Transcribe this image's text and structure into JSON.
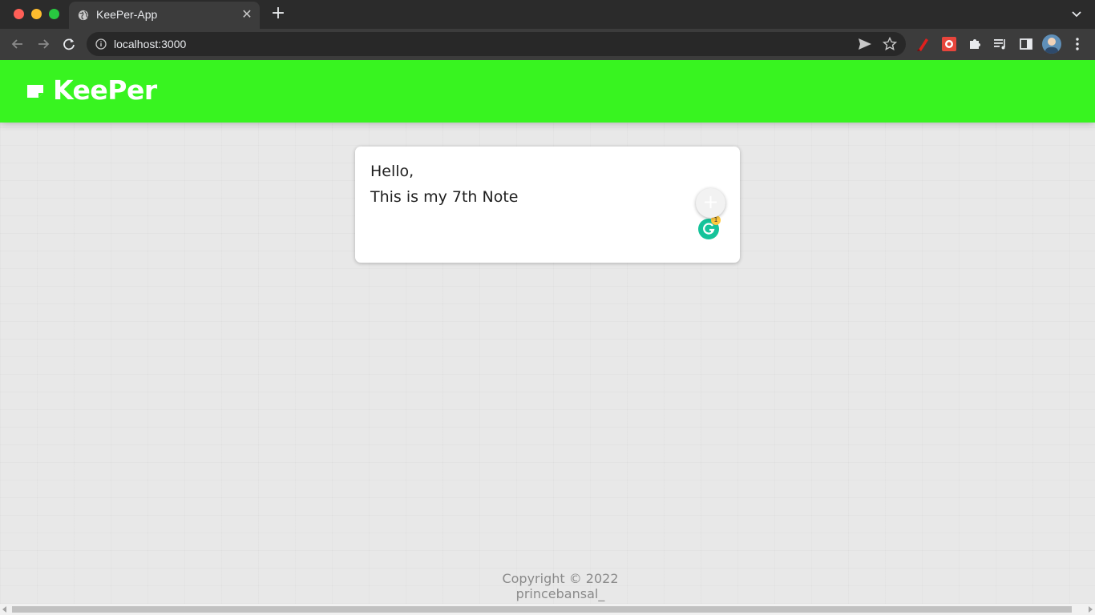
{
  "browser": {
    "tab": {
      "title": "KeePer-App",
      "close_glyph": "✕",
      "icon": "globe-icon"
    },
    "new_tab_glyph": "+",
    "address": {
      "url": "localhost:3000",
      "icon": "info-icon"
    },
    "extensions": [
      "pen-icon",
      "red-extension-icon",
      "puzzle-icon",
      "media-queue-icon",
      "side-panel-icon",
      "avatar",
      "menu-icon"
    ]
  },
  "app": {
    "header": {
      "title": "KeePer",
      "brand_color": "#38f420",
      "icon": "note-icon"
    },
    "note": {
      "lines": [
        "Hello,",
        "This is my 7th Note"
      ],
      "grammarly_count": "1",
      "add_glyph": "+"
    },
    "footer": {
      "copyright": "Copyright © 2022",
      "author": "princebansal_"
    }
  }
}
